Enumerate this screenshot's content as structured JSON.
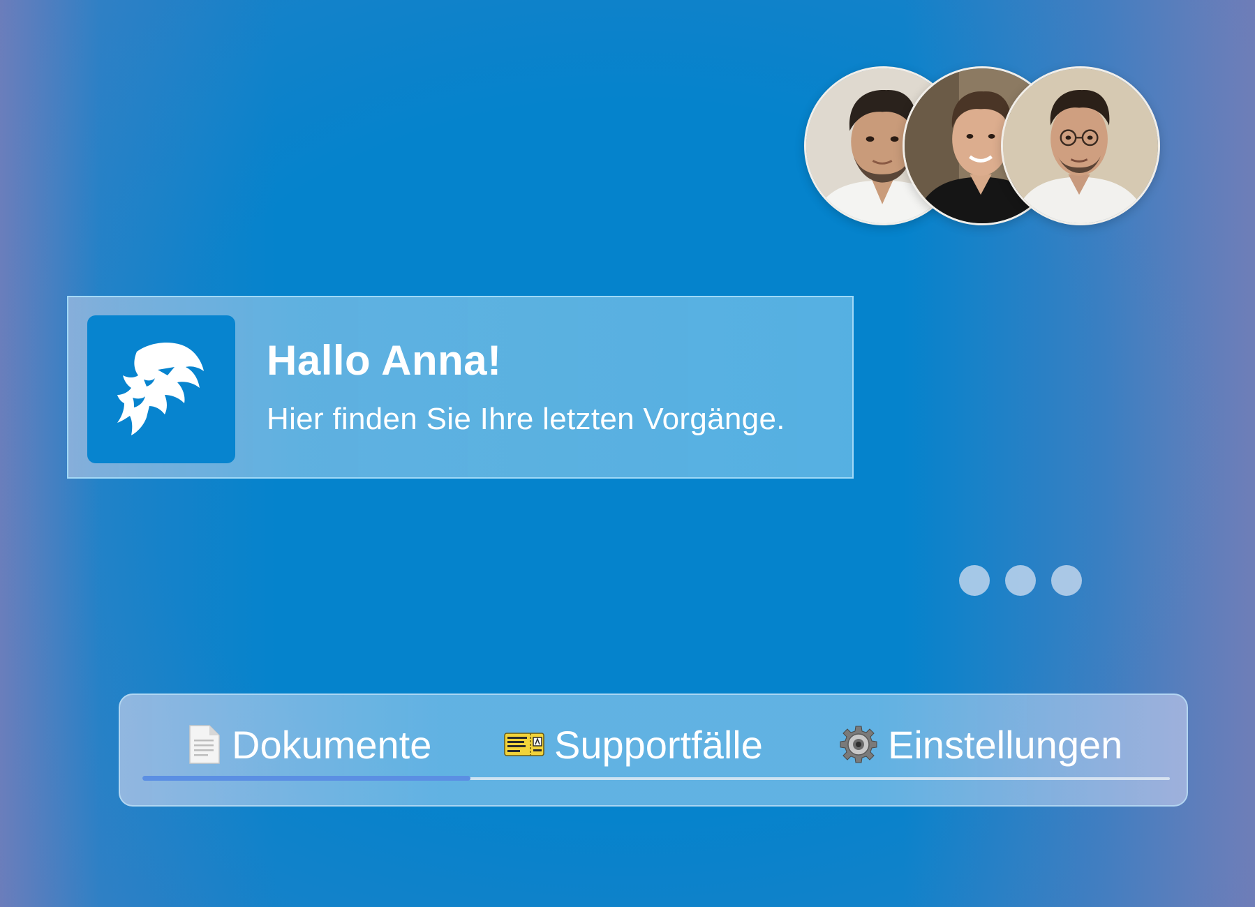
{
  "team": {
    "avatars": [
      {
        "name_tag": "team-member-1"
      },
      {
        "name_tag": "team-member-2"
      },
      {
        "name_tag": "team-member-3"
      }
    ]
  },
  "greeting": {
    "title": "Hallo Anna!",
    "subtitle": "Hier finden Sie Ihre letzten Vorgänge.",
    "logo_icon": "lion-head-icon"
  },
  "typing_indicator": {
    "dots": 3
  },
  "tabs": {
    "items": [
      {
        "label": "Dokumente",
        "icon": "document-icon",
        "active": true
      },
      {
        "label": "Supportfälle",
        "icon": "ticket-icon",
        "active": false
      },
      {
        "label": "Einstellungen",
        "icon": "gear-icon",
        "active": false
      }
    ]
  },
  "colors": {
    "background": "#0583cc",
    "brand_tile": "#0784cf",
    "active_indicator": "#5b8fe3",
    "text": "#ffffff"
  }
}
